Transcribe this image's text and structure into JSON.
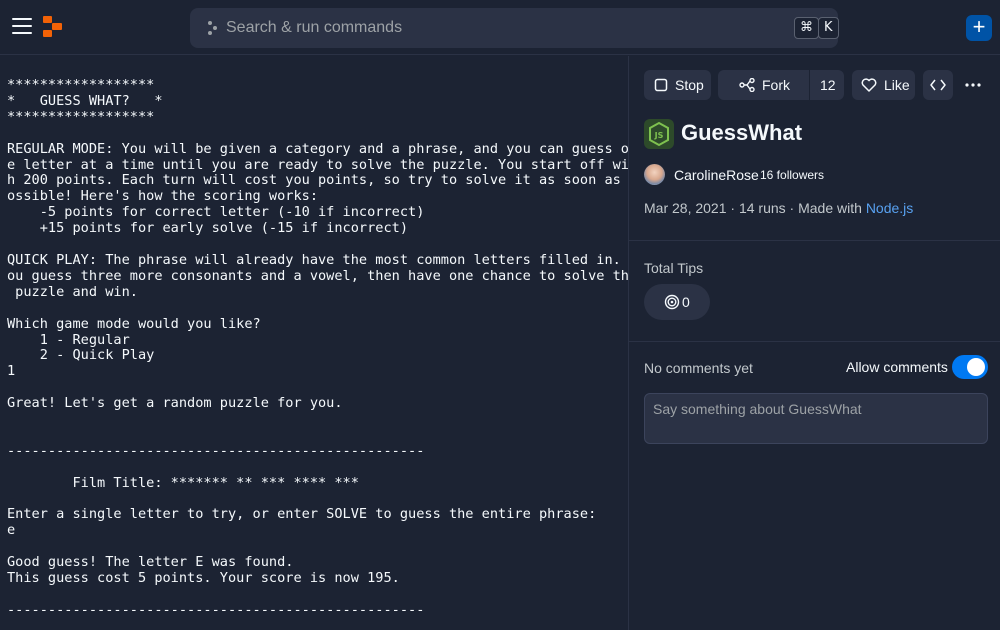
{
  "header": {
    "search_placeholder": "Search & run commands",
    "shortcut_modifier": "⌘",
    "shortcut_key": "K",
    "plus_label": "+"
  },
  "console": {
    "text": "******************\n*   GUESS WHAT?   *\n******************\n\nREGULAR MODE: You will be given a category and a phrase, and you can guess on\ne letter at a time until you are ready to solve the puzzle. You start off wit\nh 200 points. Each turn will cost you points, so try to solve it as soon as p\nossible! Here's how the scoring works:\n    -5 points for correct letter (-10 if incorrect)\n    +15 points for early solve (-15 if incorrect)\n\nQUICK PLAY: The phrase will already have the most common letters filled in. Y\nou guess three more consonants and a vowel, then have one chance to solve the\n puzzle and win.\n\nWhich game mode would you like?\n    1 - Regular\n    2 - Quick Play\n1\n\nGreat! Let's get a random puzzle for you.\n\n\n---------------------------------------------------\n\n        Film Title: ******* ** *** **** ***\n\nEnter a single letter to try, or enter SOLVE to guess the entire phrase:\ne\n\nGood guess! The letter E was found.\nThis guess cost 5 points. Your score is now 195.\n\n---------------------------------------------------"
  },
  "toolbar": {
    "stop_label": "Stop",
    "fork_label": "Fork",
    "fork_count": "12",
    "like_label": "Like"
  },
  "repl": {
    "title": "GuessWhat",
    "language_icon": "nodejs-icon",
    "author": "CarolineRose",
    "followers": "16 followers",
    "date": "Mar 28, 2021",
    "runs": "14 runs",
    "made_with_prefix": "Made with",
    "made_with": "Node.js"
  },
  "tips": {
    "label": "Total Tips",
    "count": "0"
  },
  "comments": {
    "empty_label": "No comments yet",
    "allow_label": "Allow comments",
    "allow_enabled": true,
    "placeholder": "Say something about GuessWhat"
  },
  "colors": {
    "background": "#1c2333",
    "surface": "#2b3245",
    "accent": "#0079f2",
    "link": "#58a1f0",
    "logo": "#f26207"
  }
}
